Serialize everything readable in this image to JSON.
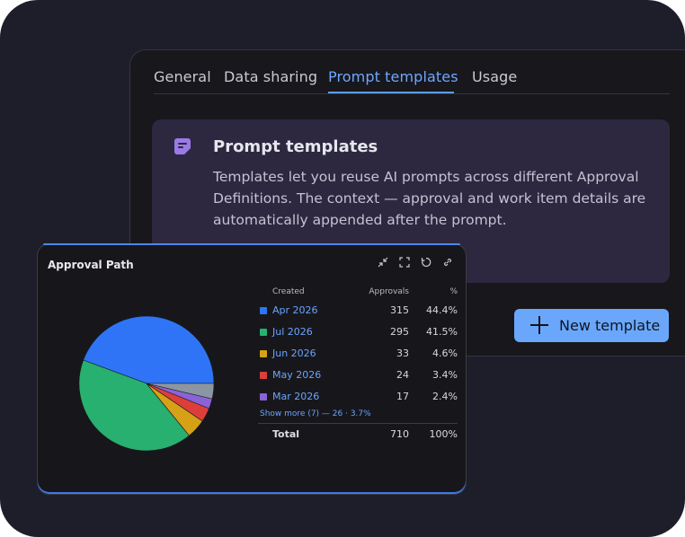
{
  "settings": {
    "tabs": [
      {
        "label": "General"
      },
      {
        "label": "Data sharing"
      },
      {
        "label": "Prompt templates",
        "active": true
      },
      {
        "label": "Usage"
      }
    ],
    "info": {
      "icon": "note-icon",
      "title": "Prompt templates",
      "body": "Templates let you reuse AI prompts across different Approval Definitions. The context — approval and work item details are automatically appended after the prompt."
    },
    "new_button": {
      "icon": "plus-icon",
      "label": "New template"
    }
  },
  "widget": {
    "title": "Approval Path",
    "tools": [
      "collapse-icon",
      "expand-icon",
      "refresh-icon",
      "link-icon"
    ],
    "columns": {
      "created": "Created",
      "approvals": "Approvals",
      "pct": "%"
    },
    "rows": [
      {
        "label": "Apr 2026",
        "approvals": "315",
        "pct": "44.4%",
        "color": "#2f74f6"
      },
      {
        "label": "Jul 2026",
        "approvals": "295",
        "pct": "41.5%",
        "color": "#27b06f"
      },
      {
        "label": "Jun 2026",
        "approvals": "33",
        "pct": "4.6%",
        "color": "#d6a116"
      },
      {
        "label": "May 2026",
        "approvals": "24",
        "pct": "3.4%",
        "color": "#dc3f3a"
      },
      {
        "label": "Mar 2026",
        "approvals": "17",
        "pct": "2.4%",
        "color": "#8a63d6"
      }
    ],
    "show_more": "Show more (7) — 26 · 3.7%",
    "total": {
      "label": "Total",
      "approvals": "710",
      "pct": "100%"
    }
  },
  "chart_data": {
    "type": "pie",
    "categories": [
      "Apr 2026",
      "Jul 2026",
      "Jun 2026",
      "May 2026",
      "Mar 2026",
      "Other"
    ],
    "values": [
      315,
      295,
      33,
      24,
      17,
      26
    ],
    "colors": [
      "#2f74f6",
      "#27b06f",
      "#d6a116",
      "#dc3f3a",
      "#8a63d6",
      "#8c96a3"
    ]
  }
}
